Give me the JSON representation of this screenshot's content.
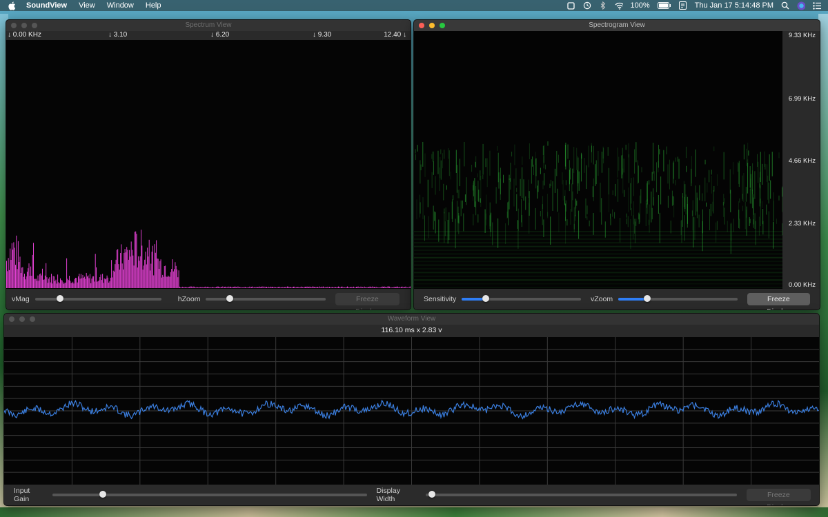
{
  "menubar": {
    "apple_icon": "apple-icon",
    "app_name": "SoundView",
    "menus": [
      "View",
      "Window",
      "Help"
    ],
    "battery": "100%",
    "datetime": "Thu Jan 17  5:14:48 PM"
  },
  "spectrum": {
    "title": "Spectrum View",
    "freq_labels": [
      "↓ 0.00 KHz",
      "↓ 3.10",
      "↓ 6.20",
      "↓ 9.30",
      "12.40 ↓"
    ],
    "controls": {
      "vmag_label": "vMag",
      "vmag_value": 0.2,
      "hzoom_label": "hZoom",
      "hzoom_value": 0.2,
      "freeze_label": "Freeze Display"
    },
    "color": "#e040d0"
  },
  "spectrogram": {
    "title": "Spectrogram View",
    "freq_labels": [
      "9.33 KHz",
      "6.99 KHz",
      "4.66 KHz",
      "2.33 KHz",
      "0.00 KHz"
    ],
    "controls": {
      "sensitivity_label": "Sensitivity",
      "sensitivity_value": 0.2,
      "vzoom_label": "vZoom",
      "vzoom_value": 0.24,
      "freeze_label": "Freeze Display"
    },
    "color": "#2fbf3a"
  },
  "waveform": {
    "title": "Waveform View",
    "readout": "116.10 ms x 2.83 v",
    "controls": {
      "input_gain_label": "Input Gain",
      "input_gain_value": 0.16,
      "display_width_label": "Display Width",
      "display_width_value": 0.02,
      "freeze_label": "Freeze Display"
    },
    "color": "#3b7fe0"
  }
}
